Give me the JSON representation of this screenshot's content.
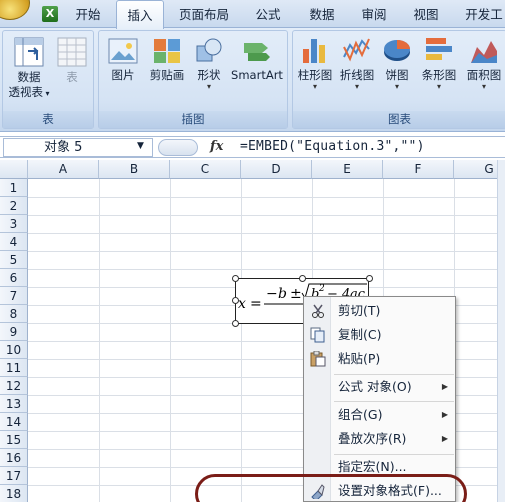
{
  "tabs": [
    {
      "label": "开始"
    },
    {
      "label": "插入"
    },
    {
      "label": "页面布局"
    },
    {
      "label": "公式"
    },
    {
      "label": "数据"
    },
    {
      "label": "审阅"
    },
    {
      "label": "视图"
    },
    {
      "label": "开发工"
    }
  ],
  "ribbon": {
    "groups": {
      "table": {
        "label": "表",
        "pivot_label_1": "数据",
        "pivot_label_2": "透视表",
        "table_label": "表"
      },
      "illustrations": {
        "label": "插图",
        "picture_label": "图片",
        "clipart_label": "剪贴画",
        "shapes_label": "形状",
        "smartart_label": "SmartArt"
      },
      "charts": {
        "label": "图表",
        "column_label": "柱形图",
        "line_label": "折线图",
        "pie_label": "饼图",
        "bar_label": "条形图",
        "area_label": "面积图"
      }
    }
  },
  "formula_bar": {
    "name_box": "对象 5",
    "fx_label": "fx",
    "formula": "=EMBED(\"Equation.3\",\"\")"
  },
  "columns": [
    "A",
    "B",
    "C",
    "D",
    "E",
    "F",
    "G"
  ],
  "rows": [
    "1",
    "2",
    "3",
    "4",
    "5",
    "6",
    "7",
    "8",
    "9",
    "10",
    "11",
    "12",
    "13",
    "14",
    "15",
    "16",
    "17",
    "18"
  ],
  "equation": {
    "text": "x = −b ± √(b² − 4ac)"
  },
  "context_menu": {
    "items": [
      {
        "label": "剪切(T)",
        "icon": "scissors-icon"
      },
      {
        "label": "复制(C)",
        "icon": "copy-icon"
      },
      {
        "label": "粘贴(P)",
        "icon": "paste-icon"
      },
      {
        "label": "公式 对象(O)",
        "icon": "",
        "submenu": true
      },
      {
        "label": "组合(G)",
        "icon": "",
        "submenu": true
      },
      {
        "label": "叠放次序(R)",
        "icon": "",
        "submenu": true
      },
      {
        "label": "指定宏(N)...",
        "icon": ""
      },
      {
        "label": "设置对象格式(F)...",
        "icon": "format-object-icon"
      }
    ]
  },
  "colors": {
    "annotation_oval": "#7a1d17",
    "ribbon_bg": "#d5e3f4"
  }
}
